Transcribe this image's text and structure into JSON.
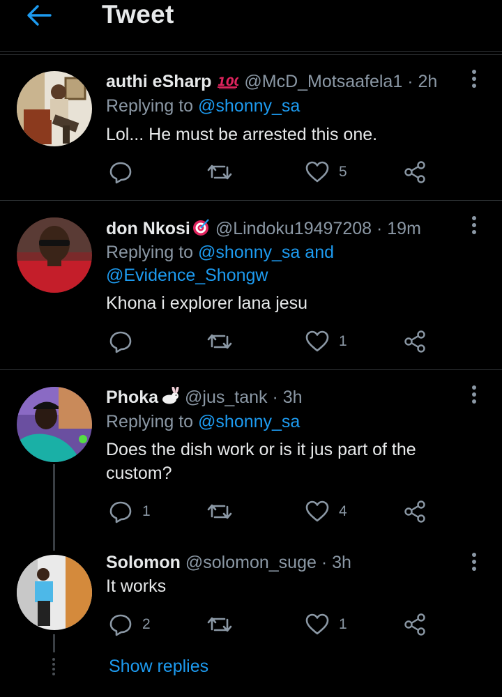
{
  "header": {
    "title": "Tweet",
    "back_icon": "arrow-left-icon",
    "accent": "#1d9bf0"
  },
  "tweets": [
    {
      "display_name": "authi eSharp",
      "name_emoji": "100-emoji-icon",
      "handle": "@McD_Motsaafela1",
      "time": "· 2h",
      "replying_prefix": "Replying to ",
      "replying_to": "@shonny_sa",
      "replying_and": "",
      "replying_to2": "",
      "text": "Lol... He must be arrested this one.",
      "reply_count": "",
      "retweet_count": "",
      "like_count": "5"
    },
    {
      "display_name": "don Nkosi",
      "name_emoji": "target-emoji-icon",
      "handle": "@Lindoku19497208",
      "time": "· 19m",
      "replying_prefix": "Replying to ",
      "replying_to": "@shonny_sa",
      "replying_and": " and",
      "replying_to2": "@Evidence_Shongw",
      "text": "Khona i explorer lana jesu",
      "reply_count": "",
      "retweet_count": "",
      "like_count": "1"
    },
    {
      "display_name": "Phoka",
      "name_emoji": "rabbit-emoji-icon",
      "handle": "@jus_tank",
      "time": "· 3h",
      "replying_prefix": "Replying to ",
      "replying_to": "@shonny_sa",
      "replying_and": "",
      "replying_to2": "",
      "text": "Does the dish work or is it jus part of the custom?",
      "reply_count": "1",
      "retweet_count": "",
      "like_count": "4"
    },
    {
      "display_name": "Solomon",
      "name_emoji": "",
      "handle": "@solomon_suge",
      "time": "· 3h",
      "replying_prefix": "",
      "replying_to": "",
      "replying_and": "",
      "replying_to2": "",
      "text": "It works",
      "reply_count": "2",
      "retweet_count": "",
      "like_count": "1"
    }
  ],
  "show_replies": "Show replies"
}
